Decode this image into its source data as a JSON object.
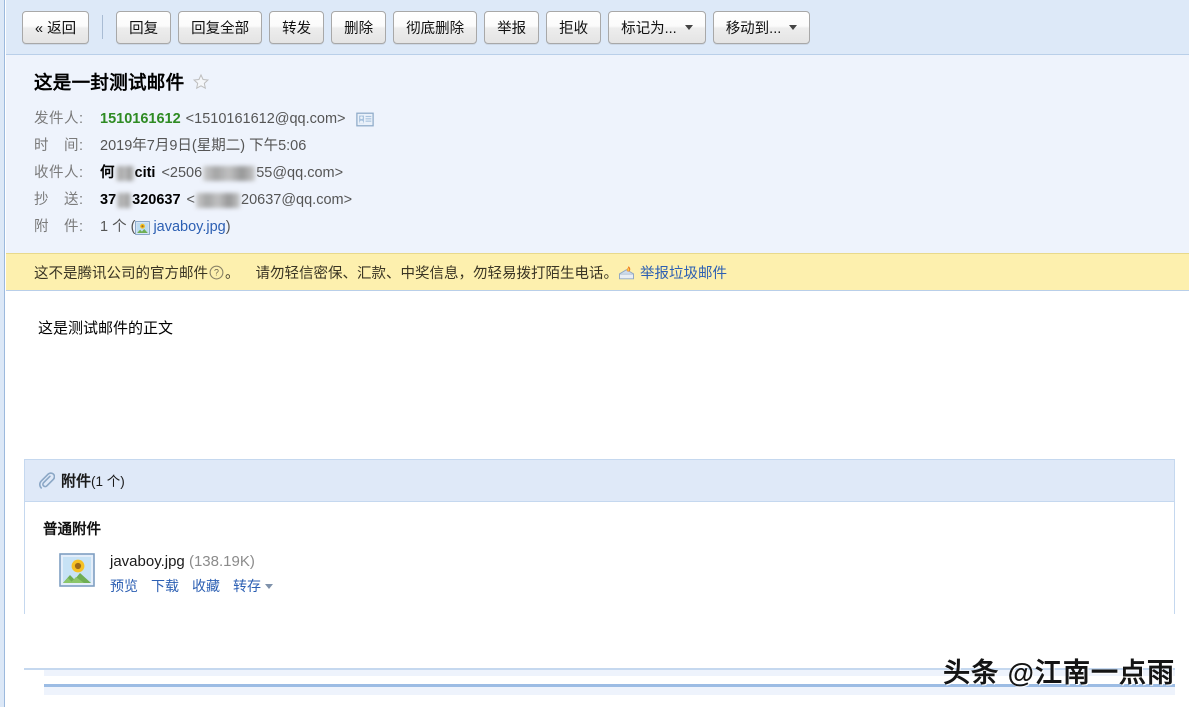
{
  "toolbar": {
    "buttons": [
      {
        "label": "« 返回",
        "dropdown": false
      },
      {
        "label": "回复",
        "dropdown": false
      },
      {
        "label": "回复全部",
        "dropdown": false
      },
      {
        "label": "转发",
        "dropdown": false
      },
      {
        "label": "删除",
        "dropdown": false
      },
      {
        "label": "彻底删除",
        "dropdown": false
      },
      {
        "label": "举报",
        "dropdown": false
      },
      {
        "label": "拒收",
        "dropdown": false
      },
      {
        "label": "标记为...",
        "dropdown": true
      },
      {
        "label": "移动到...",
        "dropdown": true
      }
    ]
  },
  "mail": {
    "subject": "这是一封测试邮件",
    "star_icon": "star-outline-icon",
    "from": {
      "label": "发件人:",
      "name": "1510161612",
      "address": "<1510161612@qq.com>",
      "contact_card_icon": "contact-card-icon"
    },
    "date": {
      "label": "时　间:",
      "value": "2019年7月9日(星期二) 下午5:06"
    },
    "to": {
      "label": "收件人:",
      "name_prefix": "何",
      "name_suffix": "citi",
      "address_prefix": "<2506",
      "address_suffix": "55@qq.com>"
    },
    "cc": {
      "label": "抄　送:",
      "name_prefix": "37",
      "name_suffix": "320637",
      "address_prefix": "<",
      "address_suffix": "20637@qq.com>"
    },
    "attach_line": {
      "label": "附　件:",
      "count_text": "1 个 (",
      "file_name": "javaboy.jpg",
      "close_paren": ")",
      "thumb_icon": "sunflower-thumbnail-icon"
    },
    "body_text": "这是测试邮件的正文"
  },
  "warning": {
    "text_before": "这不是腾讯公司的官方邮件",
    "help_icon": "question-mark-circle-icon",
    "text_after": "。",
    "advice": "请勿轻信密保、汇款、中奖信息，勿轻易拨打陌生电话。",
    "report_icon": "spam-mailbox-icon",
    "report_link": "举报垃圾邮件"
  },
  "attachments": {
    "panel_icon": "paperclip-icon",
    "panel_title": "附件",
    "panel_count": "(1 个)",
    "group_title": "普通附件",
    "items": [
      {
        "thumb_icon": "sunflower-photo-icon",
        "name": "javaboy.jpg",
        "size": "(138.19K)",
        "actions": [
          "预览",
          "下载",
          "收藏"
        ],
        "dropdown_action": "转存"
      }
    ]
  },
  "watermark": {
    "text": "头条 @江南一点雨"
  },
  "colors": {
    "toolbar_bg": "#dde9f8",
    "header_bg": "#eef3fc",
    "warning_bg": "#fdf0ae",
    "sender_green": "#2f8b23",
    "link_blue": "#2c5fb3"
  }
}
